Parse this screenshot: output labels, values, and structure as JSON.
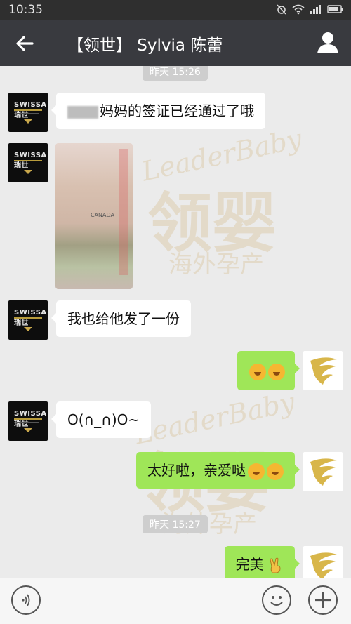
{
  "status_bar": {
    "time": "10:35",
    "icons": [
      "alarm-off-icon",
      "wifi-icon",
      "signal-icon",
      "battery-icon"
    ]
  },
  "header": {
    "title": "【领世】 Sylvia 陈蕾"
  },
  "timestamps": [
    "昨天 15:26",
    "昨天 15:27"
  ],
  "messages": [
    {
      "side": "in",
      "text": "妈妈的签证已经通过了哦"
    },
    {
      "side": "in",
      "type": "image",
      "caption": "CANADA"
    },
    {
      "side": "in",
      "text": "我也给他发了一份"
    },
    {
      "side": "out",
      "emoji": 2
    },
    {
      "side": "in",
      "text": "O(∩_∩)O~"
    },
    {
      "side": "out",
      "text": "太好啦，亲爱哒",
      "emoji": 2
    },
    {
      "side": "out",
      "text": "完美"
    }
  ],
  "avatar_brand": "SWISSA 瑞世",
  "watermark": {
    "en": "LeaderBaby",
    "cn": "领婴",
    "sub": "海外孕产"
  },
  "colors": {
    "titlebar": "#393a3f",
    "out_bubble": "#9fe658",
    "in_bubble": "#ffffff",
    "chat_bg": "#ebebeb"
  }
}
